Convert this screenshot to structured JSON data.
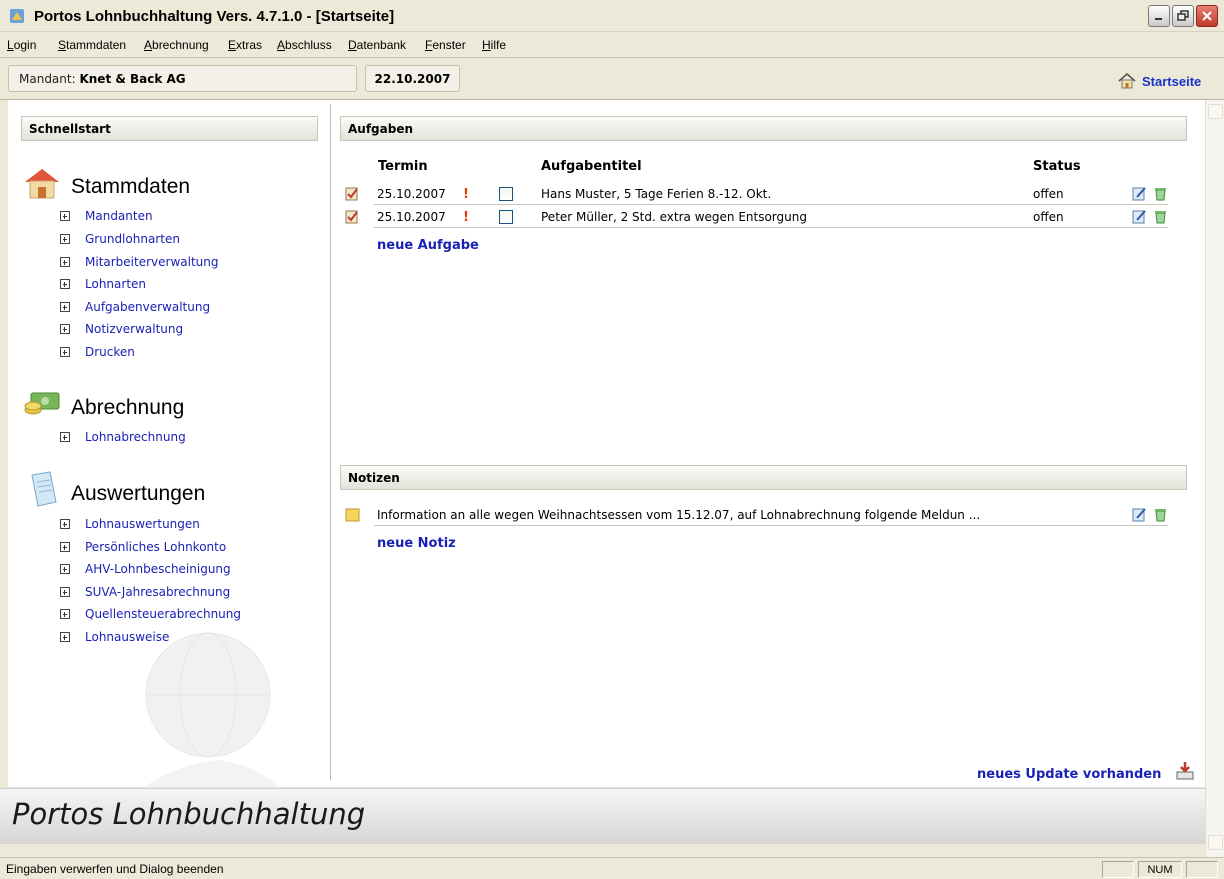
{
  "window": {
    "title": "Portos Lohnbuchhaltung Vers. 4.7.1.0 - [Startseite]"
  },
  "menu": [
    "Login",
    "Stammdaten",
    "Abrechnung",
    "Extras",
    "Abschluss",
    "Datenbank",
    "Fenster",
    "Hilfe"
  ],
  "mandant": {
    "label": "Mandant:",
    "name": "Knet & Back AG",
    "date": "22.10.2007"
  },
  "home_link": {
    "label": "Startseite",
    "icon": "home-icon"
  },
  "schnellstart": {
    "header": "Schnellstart",
    "sections": [
      {
        "title": "Stammdaten",
        "icon": "house-icon",
        "items": [
          "Mandanten",
          "Grundlohnarten",
          "Mitarbeiterverwaltung",
          "Lohnarten",
          "Aufgabenverwaltung",
          "Notizverwaltung",
          "Drucken"
        ]
      },
      {
        "title": "Abrechnung",
        "icon": "money-icon",
        "items": [
          "Lohnabrechnung"
        ]
      },
      {
        "title": "Auswertungen",
        "icon": "document-icon",
        "items": [
          "Lohnauswertungen",
          "Persönliches Lohnkonto",
          "AHV-Lohnbescheinigung",
          "SUVA-Jahresabrechnung",
          "Quellensteuerabrechnung",
          "Lohnausweise"
        ]
      }
    ]
  },
  "aufgaben": {
    "header": "Aufgaben",
    "columns": {
      "termin": "Termin",
      "titel": "Aufgabentitel",
      "status": "Status"
    },
    "rows": [
      {
        "termin": "25.10.2007",
        "priority": "!",
        "titel": "Hans Muster, 5 Tage Ferien 8.-12. Okt.",
        "status": "offen"
      },
      {
        "termin": "25.10.2007",
        "priority": "!",
        "titel": "Peter Müller, 2 Std. extra wegen Entsorgung",
        "status": "offen"
      }
    ],
    "new_label": "neue Aufgabe"
  },
  "notizen": {
    "header": "Notizen",
    "rows": [
      {
        "text": "Information an alle wegen Weihnachtsessen vom 15.12.07, auf Lohnabrechnung folgende Meldun ..."
      }
    ],
    "new_label": "neue Notiz"
  },
  "update_link": "neues Update vorhanden",
  "footer_brand": "Portos Lohnbuchhaltung",
  "statusbar": {
    "text": "Eingaben verwerfen und Dialog beenden",
    "num": "NUM"
  },
  "colors": {
    "link": "#1a22b4",
    "priority": "#e04000",
    "chrome": "#ece9d8"
  }
}
